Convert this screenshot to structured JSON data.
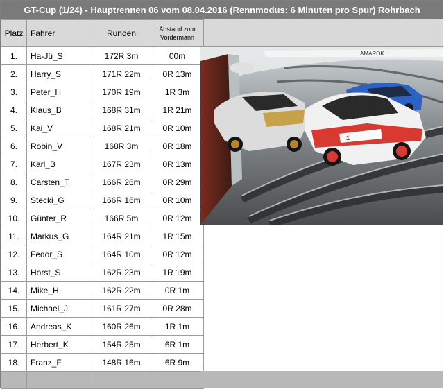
{
  "title": "GT-Cup (1/24)  -  Hauptrennen 06 vom 08.04.2016 (Rennmodus: 6 Minuten pro Spur) Rohrbach",
  "columns": {
    "platz": "Platz",
    "fahrer": "Fahrer",
    "runden": "Runden",
    "abstand": "Abstand zum Vordermann"
  },
  "rows": [
    {
      "platz": "1.",
      "fahrer": "Ha-Jü_S",
      "runden": "172R 3m",
      "abstand": "00m"
    },
    {
      "platz": "2.",
      "fahrer": "Harry_S",
      "runden": "171R 22m",
      "abstand": "0R 13m"
    },
    {
      "platz": "3.",
      "fahrer": "Peter_H",
      "runden": "170R 19m",
      "abstand": "1R 3m"
    },
    {
      "platz": "4.",
      "fahrer": "Klaus_B",
      "runden": "168R 31m",
      "abstand": "1R 21m"
    },
    {
      "platz": "5.",
      "fahrer": "Kai_V",
      "runden": "168R 21m",
      "abstand": "0R 10m"
    },
    {
      "platz": "6.",
      "fahrer": "Robin_V",
      "runden": "168R 3m",
      "abstand": "0R 18m"
    },
    {
      "platz": "7.",
      "fahrer": "Karl_B",
      "runden": "167R 23m",
      "abstand": "0R 13m"
    },
    {
      "platz": "8.",
      "fahrer": "Carsten_T",
      "runden": "166R 26m",
      "abstand": "0R 29m"
    },
    {
      "platz": "9.",
      "fahrer": "Stecki_G",
      "runden": "166R 16m",
      "abstand": "0R 10m"
    },
    {
      "platz": "10.",
      "fahrer": "Günter_R",
      "runden": "166R 5m",
      "abstand": "0R 12m"
    },
    {
      "platz": "11.",
      "fahrer": "Markus_G",
      "runden": "164R 21m",
      "abstand": "1R 15m"
    },
    {
      "platz": "12.",
      "fahrer": "Fedor_S",
      "runden": "164R 10m",
      "abstand": "0R 12m"
    },
    {
      "platz": "13.",
      "fahrer": "Horst_S",
      "runden": "162R 23m",
      "abstand": "1R 19m"
    },
    {
      "platz": "14.",
      "fahrer": "Mike_H",
      "runden": "162R 22m",
      "abstand": "0R 1m"
    },
    {
      "platz": "15.",
      "fahrer": "Michael_J",
      "runden": "161R 27m",
      "abstand": "0R 28m"
    },
    {
      "platz": "16.",
      "fahrer": "Andreas_K",
      "runden": "160R 26m",
      "abstand": "1R 1m"
    },
    {
      "platz": "17.",
      "fahrer": "Herbert_K",
      "runden": "154R 25m",
      "abstand": "6R 1m"
    },
    {
      "platz": "18.",
      "fahrer": "Franz_F",
      "runden": "148R 16m",
      "abstand": "6R 9m"
    }
  ],
  "photo": {
    "icon": "slot-car-race-photo",
    "car_number": "1",
    "banner_text": "AMAROK",
    "colors": {
      "header": "#7a7a7a",
      "header_row": "#d9d9d9",
      "footer": "#b8b8b8",
      "grid_line": "#9a9a9a"
    }
  }
}
